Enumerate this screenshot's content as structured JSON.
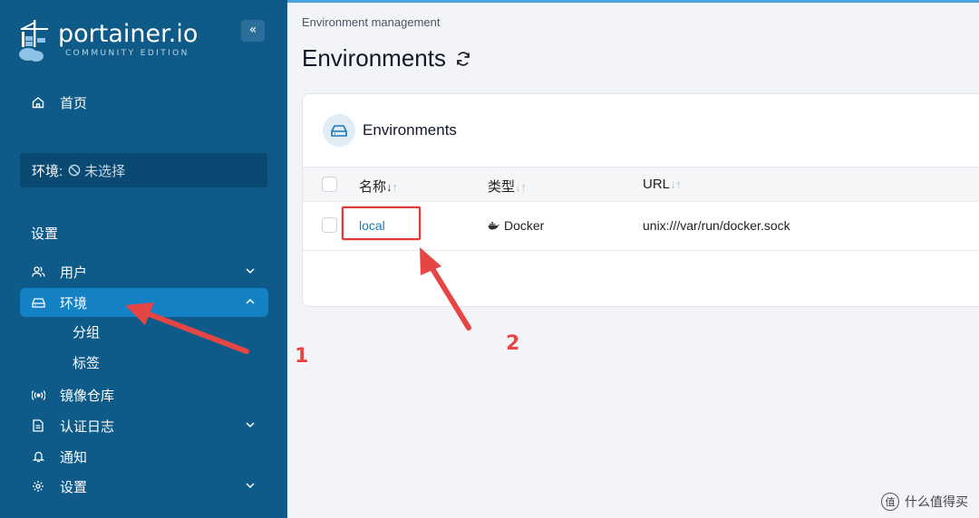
{
  "app": {
    "logo_text": "portainer.io",
    "logo_subtitle": "COMMUNITY EDITION",
    "collapse_glyph": "«"
  },
  "sidebar": {
    "home_label": "首页",
    "environment_label": "环境:",
    "environment_value": "未选择",
    "section_title": "设置",
    "items": [
      {
        "label": "用户",
        "icon": "users-icon",
        "expandable": true,
        "expanded": false
      },
      {
        "label": "环境",
        "icon": "environment-icon",
        "expandable": true,
        "expanded": true,
        "active": true
      },
      {
        "label": "镜像仓库",
        "icon": "registry-icon",
        "expandable": false
      },
      {
        "label": "认证日志",
        "icon": "log-icon",
        "expandable": true,
        "expanded": false
      },
      {
        "label": "通知",
        "icon": "bell-icon",
        "expandable": false
      },
      {
        "label": "设置",
        "icon": "gear-icon",
        "expandable": true,
        "expanded": false
      }
    ],
    "sub_items": [
      "分组",
      "标签"
    ]
  },
  "main": {
    "breadcrumb": "Environment management",
    "page_title": "Environments",
    "card_title": "Environments",
    "columns": [
      {
        "label": "名称",
        "sort": "↓↑"
      },
      {
        "label": "类型",
        "sort": "↓↑"
      },
      {
        "label": "URL",
        "sort": "↓↑"
      }
    ],
    "rows": [
      {
        "name": "local",
        "type": "Docker",
        "url": "unix:///var/run/docker.sock"
      }
    ]
  },
  "annotations": {
    "label_1": "1",
    "label_2": "2",
    "arrow_color": "#e64545"
  },
  "watermark": {
    "glyph": "值",
    "text": "什么值得买"
  },
  "colors": {
    "sidebar_bg": "#0e5a88",
    "active_item_bg": "#1581c5",
    "link": "#1d7ab8"
  }
}
